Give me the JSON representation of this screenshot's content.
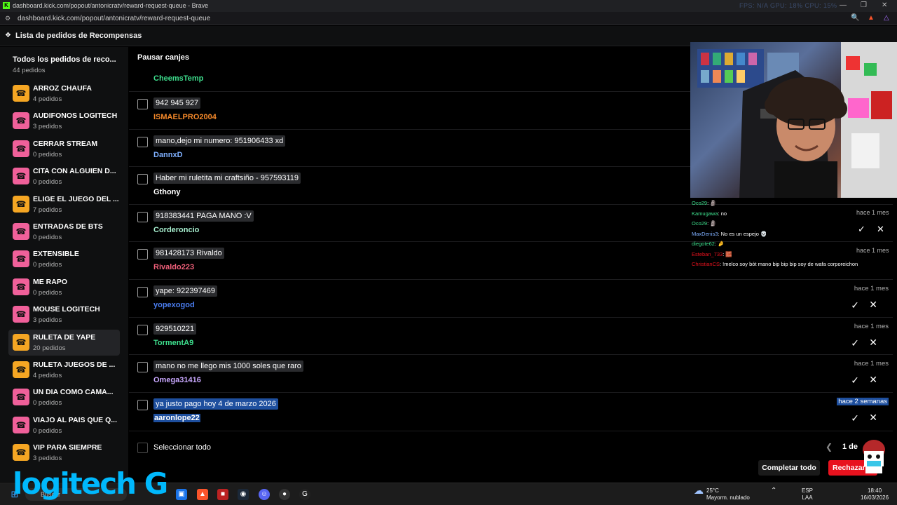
{
  "browser": {
    "title": "dashboard.kick.com/popout/antonicratv/reward-request-queue - Brave",
    "url": "dashboard.kick.com/popout/antonicratv/reward-request-queue",
    "overlay_stats": "FPS: N/A    GPU: 18%    CPU: 15%"
  },
  "header": {
    "title": "Lista de pedidos de Recompensas"
  },
  "sidebar": {
    "all": {
      "title": "Todos los pedidos de reco...",
      "count": "44 pedidos"
    },
    "items": [
      {
        "name": "ARROZ CHAUFA",
        "count": "4 pedidos",
        "color": "#f5a623"
      },
      {
        "name": "AUDIFONOS LOGITECH",
        "count": "3 pedidos",
        "color": "#f0609a"
      },
      {
        "name": "CERRAR STREAM",
        "count": "0 pedidos",
        "color": "#f0609a"
      },
      {
        "name": "CITA CON ALGUIEN D...",
        "count": "0 pedidos",
        "color": "#f0609a"
      },
      {
        "name": "ELIGE EL JUEGO DEL ...",
        "count": "7 pedidos",
        "color": "#f5a623"
      },
      {
        "name": "ENTRADAS DE BTS",
        "count": "0 pedidos",
        "color": "#f0609a"
      },
      {
        "name": "EXTENSIBLE",
        "count": "0 pedidos",
        "color": "#f0609a"
      },
      {
        "name": "ME RAPO",
        "count": "0 pedidos",
        "color": "#f0609a"
      },
      {
        "name": "MOUSE LOGITECH",
        "count": "3 pedidos",
        "color": "#f0609a"
      },
      {
        "name": "RULETA DE YAPE",
        "count": "20 pedidos",
        "color": "#f5a623",
        "active": true
      },
      {
        "name": "RULETA JUEGOS DE ...",
        "count": "4 pedidos",
        "color": "#f5a623"
      },
      {
        "name": "UN DIA COMO CAMA...",
        "count": "0 pedidos",
        "color": "#f0609a"
      },
      {
        "name": "VIAJO AL PAIS QUE Q...",
        "count": "0 pedidos",
        "color": "#f0609a"
      },
      {
        "name": "VIP PARA SIEMPRE",
        "count": "3 pedidos",
        "color": "#f5a623"
      }
    ]
  },
  "main": {
    "pause_label": "Pausar canjes",
    "first_user": {
      "name": "CheemsTemp",
      "color": "#3ee08e"
    },
    "requests": [
      {
        "message": "942 945 927",
        "user": "ISMAELPRO2004",
        "color": "#f5892a",
        "time": "",
        "show_actions": false
      },
      {
        "message": "mano,dejo mi numero: 951906433 xd",
        "user": "DannxD",
        "color": "#7fb0ff",
        "time": "",
        "show_actions": false
      },
      {
        "message": "Haber mi ruletita mi craftsiño - 957593119",
        "user": "Gthony",
        "color": "#ffffff",
        "time": "",
        "show_actions": false
      },
      {
        "message": "918383441 PAGA MANO :V",
        "user": "Corderoncio",
        "color": "#a8f0d0",
        "time": "hace 1 mes",
        "show_actions": false
      },
      {
        "message": "981428173 Rivaldo",
        "user": "Rivaldo223",
        "color": "#f0607a",
        "time": "hace 1 mes",
        "show_actions": false
      },
      {
        "message": "yape: 922397469",
        "user": "yopexogod",
        "color": "#4a7df0",
        "time": "hace 1 mes",
        "show_actions": true
      },
      {
        "message": "929510221",
        "user": "TormentA9",
        "color": "#3ee08e",
        "time": "hace 1 mes",
        "show_actions": true
      },
      {
        "message": "mano no me llego mis 1000 soles que raro",
        "user": "Omega31416",
        "color": "#c9a8ff",
        "time": "hace 1 mes",
        "show_actions": true
      },
      {
        "message": "ya justo pago hoy 4 de marzo 2026",
        "user": "aaronlope22",
        "color": "#ffffff",
        "time": "hace 2 semanas",
        "show_actions": true,
        "selected": true
      }
    ],
    "select_all_label": "Seleccionar todo",
    "page_label": "1 de",
    "complete_all_label": "Completar todo",
    "reject_all_label": "Rechazar todo"
  },
  "chat_overlay": [
    {
      "user": "Oco29",
      "text": ": 🗿",
      "color": "#3ee08e"
    },
    {
      "user": "Kamugawa",
      "text": ": no",
      "color": "#3ee08e"
    },
    {
      "user": "Oco29",
      "text": ": 🗿",
      "color": "#3ee08e"
    },
    {
      "user": "MaxDenis3",
      "text": ": No es un espejo 💀",
      "color": "#7fb0ff"
    },
    {
      "user": "diegote62",
      "text": ": 🤌",
      "color": "#3ee08e"
    },
    {
      "user": "Esteban_733",
      "text": ": 🧱",
      "color": "#e8121e"
    },
    {
      "user": "ChristianCS",
      "text": ": !melco soy bót mano bip bip bip soy de wafa corporeichon",
      "color": "#e8121e"
    }
  ],
  "overlay_actions_time": [
    "hace 1 mes",
    "hace 1 mes"
  ],
  "watermark": "logitech G",
  "taskbar": {
    "search_placeholder": "Buscar",
    "weather_temp": "25°C",
    "weather_desc": "Mayorm. nublado",
    "lang_top": "ESP",
    "lang_bottom": "LAA",
    "time": "18:40",
    "date": "16/03/2026"
  }
}
